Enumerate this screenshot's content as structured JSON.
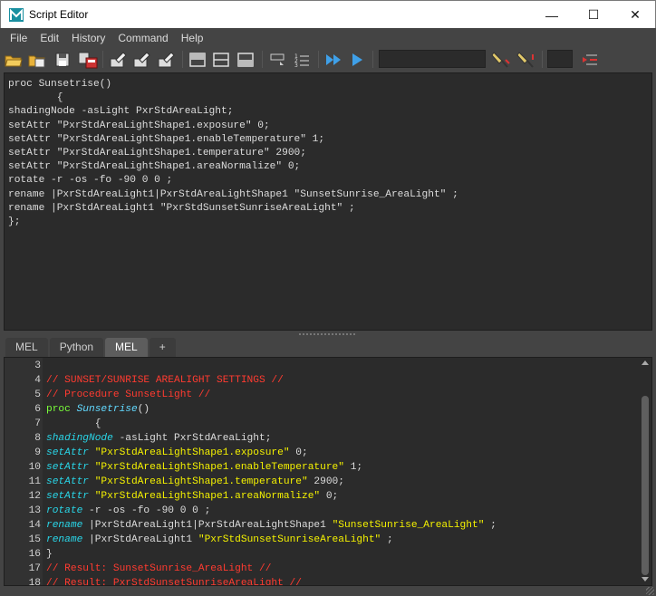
{
  "window": {
    "title": "Script Editor",
    "controls": {
      "minimize": "—",
      "maximize": "☐",
      "close": "✕"
    }
  },
  "menu": [
    "File",
    "Edit",
    "History",
    "Command",
    "Help"
  ],
  "toolbar": {
    "icons": [
      "open-script-icon",
      "source-script-icon",
      "save-script-icon",
      "save-script-to-shelf-icon",
      "clear-history-icon",
      "clear-input-icon",
      "clear-all-icon",
      "show-history-only-icon",
      "show-input-only-icon",
      "show-both-icon",
      "echo-all-commands-icon",
      "line-numbers-icon",
      "execute-all-icon",
      "execute-selected-icon",
      "search-previous-icon",
      "search-next-icon",
      "goto-line-icon"
    ],
    "search_value": "",
    "goto_value": ""
  },
  "history": {
    "lines": [
      "proc Sunsetrise()",
      "        {",
      "shadingNode -asLight PxrStdAreaLight;",
      "setAttr \"PxrStdAreaLightShape1.exposure\" 0;",
      "setAttr \"PxrStdAreaLightShape1.enableTemperature\" 1;",
      "setAttr \"PxrStdAreaLightShape1.temperature\" 2900;",
      "setAttr \"PxrStdAreaLightShape1.areaNormalize\" 0;",
      "rotate -r -os -fo -90 0 0 ;",
      "rename |PxrStdAreaLight1|PxrStdAreaLightShape1 \"SunsetSunrise_AreaLight\" ;",
      "rename |PxrStdAreaLight1 \"PxrStdSunsetSunriseAreaLight\" ;",
      "};"
    ]
  },
  "tabs": [
    {
      "label": "MEL",
      "active": false
    },
    {
      "label": "Python",
      "active": false
    },
    {
      "label": "MEL",
      "active": true
    },
    {
      "label": "+",
      "active": false
    }
  ],
  "editor": {
    "line_numbers": [
      "3",
      "4",
      "5",
      "6",
      "7",
      "8",
      "9",
      "10",
      "11",
      "12",
      "13",
      "14",
      "15",
      "16",
      "17",
      "18"
    ],
    "lines": [
      [],
      [
        {
          "t": "// SUNSET/SUNRISE AREALIGHT SETTINGS //",
          "c": "comment"
        }
      ],
      [
        {
          "t": "// Procedure SunsetLight //",
          "c": "comment"
        }
      ],
      [
        {
          "t": "proc ",
          "c": "kw"
        },
        {
          "t": "Sunsetrise",
          "c": "fn"
        },
        {
          "t": "()",
          "c": "plain"
        }
      ],
      [
        {
          "t": "        {",
          "c": "plain"
        }
      ],
      [
        {
          "t": "shadingNode",
          "c": "cmd"
        },
        {
          "t": " -asLight PxrStdAreaLight;",
          "c": "plain"
        }
      ],
      [
        {
          "t": "setAttr",
          "c": "cmd"
        },
        {
          "t": " ",
          "c": "plain"
        },
        {
          "t": "\"PxrStdAreaLightShape1.exposure\"",
          "c": "str"
        },
        {
          "t": " 0;",
          "c": "plain"
        }
      ],
      [
        {
          "t": "setAttr",
          "c": "cmd"
        },
        {
          "t": " ",
          "c": "plain"
        },
        {
          "t": "\"PxrStdAreaLightShape1.enableTemperature\"",
          "c": "str"
        },
        {
          "t": " 1;",
          "c": "plain"
        }
      ],
      [
        {
          "t": "setAttr",
          "c": "cmd"
        },
        {
          "t": " ",
          "c": "plain"
        },
        {
          "t": "\"PxrStdAreaLightShape1.temperature\"",
          "c": "str"
        },
        {
          "t": " 2900;",
          "c": "plain"
        }
      ],
      [
        {
          "t": "setAttr",
          "c": "cmd"
        },
        {
          "t": " ",
          "c": "plain"
        },
        {
          "t": "\"PxrStdAreaLightShape1.areaNormalize\"",
          "c": "str"
        },
        {
          "t": " 0;",
          "c": "plain"
        }
      ],
      [
        {
          "t": "rotate",
          "c": "cmd"
        },
        {
          "t": " -r -os -fo -90 0 0 ;",
          "c": "plain"
        }
      ],
      [
        {
          "t": "rename",
          "c": "cmd"
        },
        {
          "t": " |PxrStdAreaLight1|PxrStdAreaLightShape1 ",
          "c": "plain"
        },
        {
          "t": "\"SunsetSunrise_AreaLight\"",
          "c": "str"
        },
        {
          "t": " ;",
          "c": "plain"
        }
      ],
      [
        {
          "t": "rename",
          "c": "cmd"
        },
        {
          "t": " |PxrStdAreaLight1 ",
          "c": "plain"
        },
        {
          "t": "\"PxrStdSunsetSunriseAreaLight\"",
          "c": "str"
        },
        {
          "t": " ;",
          "c": "plain"
        }
      ],
      [
        {
          "t": "}",
          "c": "plain"
        }
      ],
      [
        {
          "t": "// Result: SunsetSunrise_AreaLight //",
          "c": "comment"
        }
      ],
      [
        {
          "t": "// Result: PxrStdSunsetSunriseAreaLight //",
          "c": "comment"
        }
      ]
    ]
  },
  "colors": {
    "background": "#444444",
    "pane": "#2b2b2b",
    "comment": "#ff3b30",
    "keyword": "#7aff3a",
    "command": "#29d6e8",
    "string": "#f5f200"
  }
}
